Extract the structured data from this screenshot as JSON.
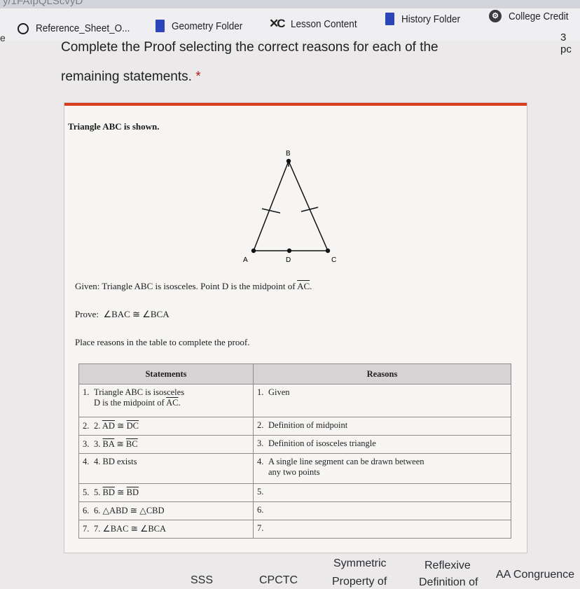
{
  "browser": {
    "url_fragment": "y/1FAIpQLScvyD",
    "bookmarks": [
      {
        "label": "Reference_Sheet_O...",
        "icon": "circle-icon"
      },
      {
        "label": "Geometry Folder",
        "icon": "folder-icon"
      },
      {
        "label": "Lesson Content",
        "icon": "x-logo-icon"
      },
      {
        "label": "History Folder",
        "icon": "folder-icon"
      },
      {
        "label": "College Credit",
        "icon": "cc-icon"
      }
    ],
    "edge_char": "e"
  },
  "question": {
    "line1": "Complete the Proof selecting the correct reasons for each of the",
    "line2": "remaining statements.",
    "required_marker": "*",
    "points": "3 pc"
  },
  "figure": {
    "intro": "Triangle ABC is shown.",
    "vertices": {
      "top": "B",
      "left": "A",
      "mid": "D",
      "right": "C"
    },
    "given_prefix": "Given: Triangle ABC is isosceles. Point D is the midpoint of ",
    "given_seg": "AC",
    "given_suffix": ".",
    "prove_label": "Prove:",
    "prove_statement": "∠BAC ≅ ∠BCA",
    "instruction": "Place reasons in the table to complete the proof."
  },
  "proof_table": {
    "headers": [
      "Statements",
      "Reasons"
    ],
    "rows": [
      {
        "num": "1.",
        "statement_a": "Triangle ABC is isosceles",
        "statement_b_prefix": "D is the midpoint of ",
        "statement_b_seg": "AC",
        "statement_b_suffix": ".",
        "reason_num": "1.",
        "reason": "Given",
        "reason_b": ""
      },
      {
        "num": "2.",
        "prefix": "2.",
        "seg1": "AD",
        "rel": "≅",
        "seg2": "DC",
        "reason_num": "2.",
        "reason": "Definition of midpoint",
        "reason_b": ""
      },
      {
        "num": "3.",
        "prefix": "3.",
        "seg1": "BA",
        "rel": "≅",
        "seg2": "BC",
        "reason_num": "3.",
        "reason": "Definition of isosceles triangle",
        "reason_b": ""
      },
      {
        "num": "4.",
        "prefix": "4.",
        "text": "BD exists",
        "reason_num": "4.",
        "reason": "A single line segment can be drawn between",
        "reason_b": "any two points"
      },
      {
        "num": "5.",
        "prefix": "5.",
        "seg1": "BD",
        "rel": "≅",
        "seg2": "BD",
        "reason_num": "5.",
        "reason": "",
        "reason_b": ""
      },
      {
        "num": "6.",
        "prefix": "6.",
        "text": "△ABD ≅ △CBD",
        "reason_num": "6.",
        "reason": "",
        "reason_b": ""
      },
      {
        "num": "7.",
        "prefix": "7.",
        "text": "∠BAC ≅ ∠BCA",
        "reason_num": "7.",
        "reason": "",
        "reason_b": ""
      }
    ]
  },
  "answer_choices": {
    "row1": [
      "Symmetric",
      "Reflexive",
      "AA Congruence"
    ],
    "row2": [
      "SSS",
      "CPCTC",
      "Property of",
      "Definition of"
    ]
  },
  "colors": {
    "accent_border": "#d93b1e",
    "folder_blue": "#2c45b8"
  }
}
